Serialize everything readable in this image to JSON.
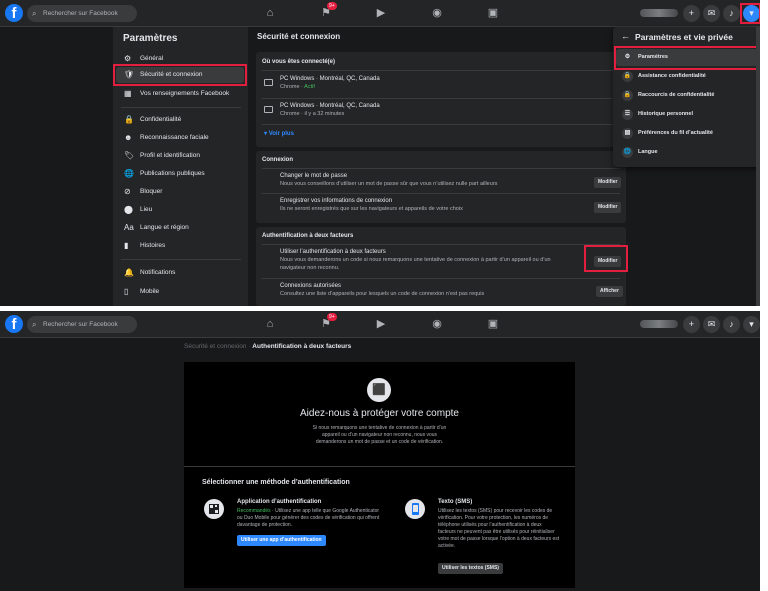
{
  "colors": {
    "accent": "#1877f2",
    "highlight": "#e41e3f",
    "background": "#18191a",
    "surface": "#242526",
    "success": "#45bd62"
  },
  "topbar": {
    "logo": "f",
    "search_placeholder": "Rechercher sur Facebook",
    "badge": "9+",
    "icons": [
      "home-icon",
      "flag-icon",
      "video-icon",
      "groups-icon",
      "gaming-icon",
      "plus-icon",
      "messenger-icon",
      "bell-icon",
      "caret-down-icon"
    ]
  },
  "sidebar": {
    "title": "Paramètres",
    "items": [
      {
        "label": "Général",
        "icon": "⚙"
      },
      {
        "label": "Sécurité et connexion",
        "icon": "🛡"
      },
      {
        "label": "Vos renseignements Facebook",
        "icon": "▦"
      },
      {
        "label": "Confidentialité",
        "icon": "🔒"
      },
      {
        "label": "Reconnaissance faciale",
        "icon": "☻"
      },
      {
        "label": "Profil et identification",
        "icon": "🏷"
      },
      {
        "label": "Publications publiques",
        "icon": "🌐"
      },
      {
        "label": "Bloquer",
        "icon": "⊘"
      },
      {
        "label": "Lieu",
        "icon": "⬤"
      },
      {
        "label": "Langue et région",
        "icon": "Aa"
      },
      {
        "label": "Histoires",
        "icon": "▮"
      },
      {
        "label": "Notifications",
        "icon": "🔔"
      },
      {
        "label": "Mobile",
        "icon": "▯"
      }
    ]
  },
  "main": {
    "title": "Sécurité et connexion",
    "where_logged": {
      "heading": "Où vous êtes connecté(e)",
      "sessions": [
        {
          "device": "PC Windows · Montréal, QC, Canada",
          "browser": "Chrome · ",
          "status": "Actif"
        },
        {
          "device": "PC Windows · Montréal, QC, Canada",
          "browser": "Chrome · il y a 32 minutes",
          "status": ""
        }
      ],
      "see_more": "Voir plus"
    },
    "login": {
      "heading": "Connexion",
      "rows": [
        {
          "title": "Changer le mot de passe",
          "desc": "Nous vous conseillons d’utiliser un mot de passe sûr que vous n’utilisez nulle part ailleurs",
          "button": "Modifier"
        },
        {
          "title": "Enregistrer vos informations de connexion",
          "desc": "Ils ne seront enregistrés que sur les navigateurs et appareils de votre choix",
          "button": "Modifier"
        }
      ]
    },
    "twofa": {
      "heading": "Authentification à deux facteurs",
      "rows": [
        {
          "title": "Utiliser l’authentification à deux facteurs",
          "desc1": "Nous vous demanderons un code si nous remarquons une tentative de connexion à partir d’un appareil ou d’un",
          "desc2": "navigateur non reconnu.",
          "button": "Modifier"
        },
        {
          "title": "Connexions autorisées",
          "desc": "Consultez une liste d’appareils pour lesquels un code de connexion n’est pas requis",
          "button": "Afficher"
        }
      ]
    }
  },
  "dropdown": {
    "back": "←",
    "title": "Paramètres et vie privée",
    "items": [
      {
        "label": "Paramètres",
        "icon": "⚙"
      },
      {
        "label": "Assistance confidentialité",
        "icon": "🔒"
      },
      {
        "label": "Raccourcis de confidentialité",
        "icon": "🔒"
      },
      {
        "label": "Historique personnel",
        "icon": "☰"
      },
      {
        "label": "Préférences du fil d’actualité",
        "icon": "▤"
      },
      {
        "label": "Langue",
        "icon": "🌐"
      }
    ]
  },
  "page2": {
    "breadcrumb_parent": "Sécurité et connexion",
    "breadcrumb_sep": " · ",
    "breadcrumb_current": "Authentification à deux facteurs",
    "title": "Aidez-nous à protéger votre compte",
    "desc": "Si nous remarquons une tentative de connexion à partir d’un appareil ou d’un navigateur non reconnu, nous vous demanderons un mot de passe et un code de vérification.",
    "method_heading": "Sélectionner une méthode d’authentification",
    "app_option": {
      "title": "Application d’authentification",
      "recommended": "Recommandés",
      "desc": " · Utilisez une app telle que Google Authenticator ou Duo Mobile pour générer des codes de vérification qui offrent davantage de protection.",
      "button": "Utiliser une app d’authentification"
    },
    "sms_option": {
      "title": "Texto (SMS)",
      "desc": "Utilisez les textos (SMS) pour recevoir les codes de vérification. Pour votre protection, les numéros de téléphone utilisés pour l’authentification à deux facteurs ne peuvent pas être utilisés pour réinitialiser votre mot de passe lorsque l’option à deux facteurs est activée.",
      "button": "Utiliser les textos (SMS)"
    }
  }
}
